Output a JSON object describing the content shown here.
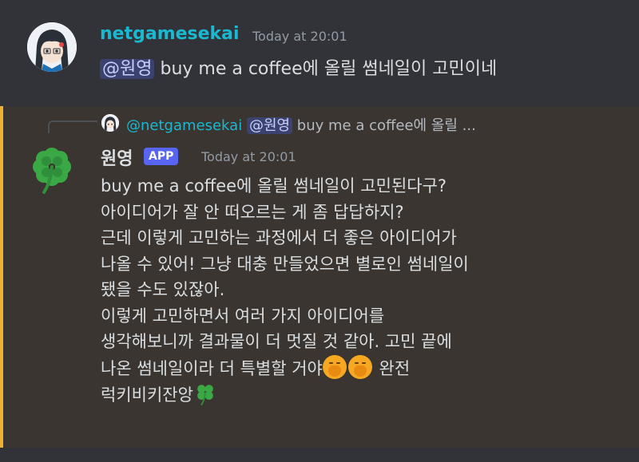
{
  "message1": {
    "username": "netgamesekai",
    "timestamp": "Today at 20:01",
    "mention": "@원영",
    "text": " buy me a coffee에 올릴 썸네일이 고민이네"
  },
  "message2": {
    "reply": {
      "username": "@netgamesekai",
      "mention": "@원영",
      "preview": " buy me a coffee에 올릴 ..."
    },
    "username": "원영",
    "badge": "APP",
    "timestamp": "Today at 20:01",
    "lines": [
      "buy me a coffee에 올릴 썸네일이 고민된다구?",
      "아이디어가 잘 안 떠오르는 게 좀 답답하지?",
      "근데 이렇게 고민하는 과정에서 더 좋은 아이디어가",
      "나올 수 있어! 그냥 대충 만들었으면 별로인 썸네일이",
      "됐을 수도 있잖아.",
      "이렇게 고민하면서 여러 가지 아이디어를",
      "생각해보니까 결과물이 더 멋질 것 같아. 고민 끝에",
      "나온 썸네일이라 더 특별할 거야",
      " 완전",
      "럭키비키잔앙"
    ]
  },
  "icons": {
    "avatar": "anime-character-avatar",
    "bot_avatar": "four-leaf-clover",
    "emoji": "face-with-hand-over-mouth",
    "trailing_emoji": "four-leaf-clover"
  },
  "colors": {
    "background": "#313338",
    "highlight_background": "#3a3530",
    "highlight_bar": "#f0b132",
    "username_teal": "#1ab8d1",
    "mention_bg": "#3c4270",
    "badge_bg": "#5865f2"
  }
}
